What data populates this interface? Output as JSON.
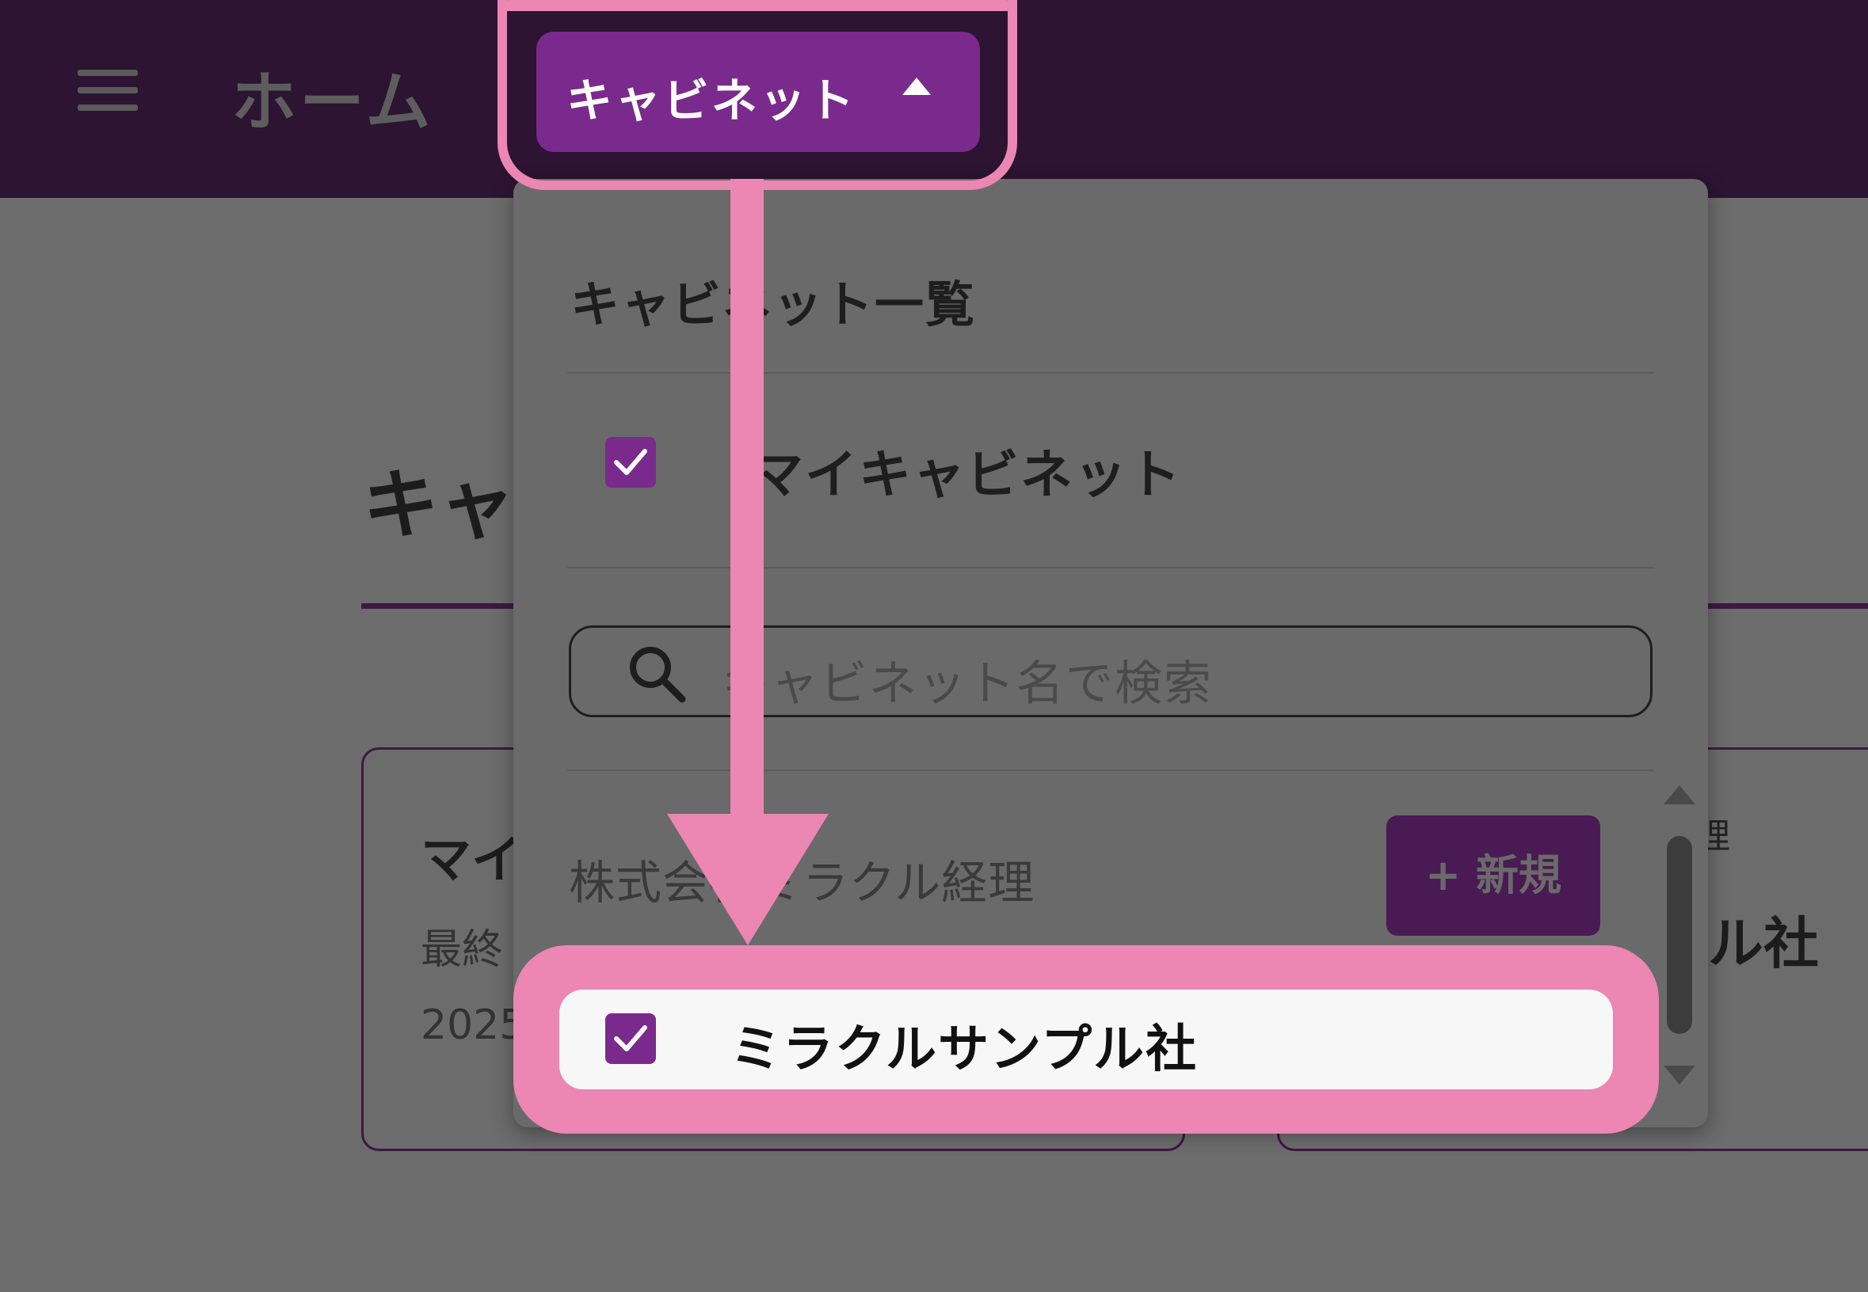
{
  "header": {
    "menu_icon": "hamburger-menu-icon",
    "home_label": "ホーム",
    "cabinet_button_label": "キャビネット",
    "cabinet_button_icon": "caret-up-icon"
  },
  "background": {
    "page_title": "キャ",
    "card1": {
      "title": "マイ",
      "meta": "最終",
      "date": "2025"
    },
    "card2": {
      "subtitle": "理",
      "title": "ル社"
    }
  },
  "dropdown": {
    "heading": "キャビネット一覧",
    "my_cabinet": {
      "label": "マイキャビネット",
      "checked": true
    },
    "search": {
      "placeholder": "キャビネット名で検索",
      "icon": "search-icon"
    },
    "org_name": "株式会社ミラクル経理",
    "new_button_label": "+ 新規",
    "items": [
      {
        "label": "ミラクルサンプル社",
        "checked": true
      }
    ]
  },
  "colors": {
    "header_bg": "#2c1432",
    "accent_purple": "#7a2a8c",
    "highlight_pink": "#ec86b2",
    "overlay_gray": "#6c6c6c"
  }
}
